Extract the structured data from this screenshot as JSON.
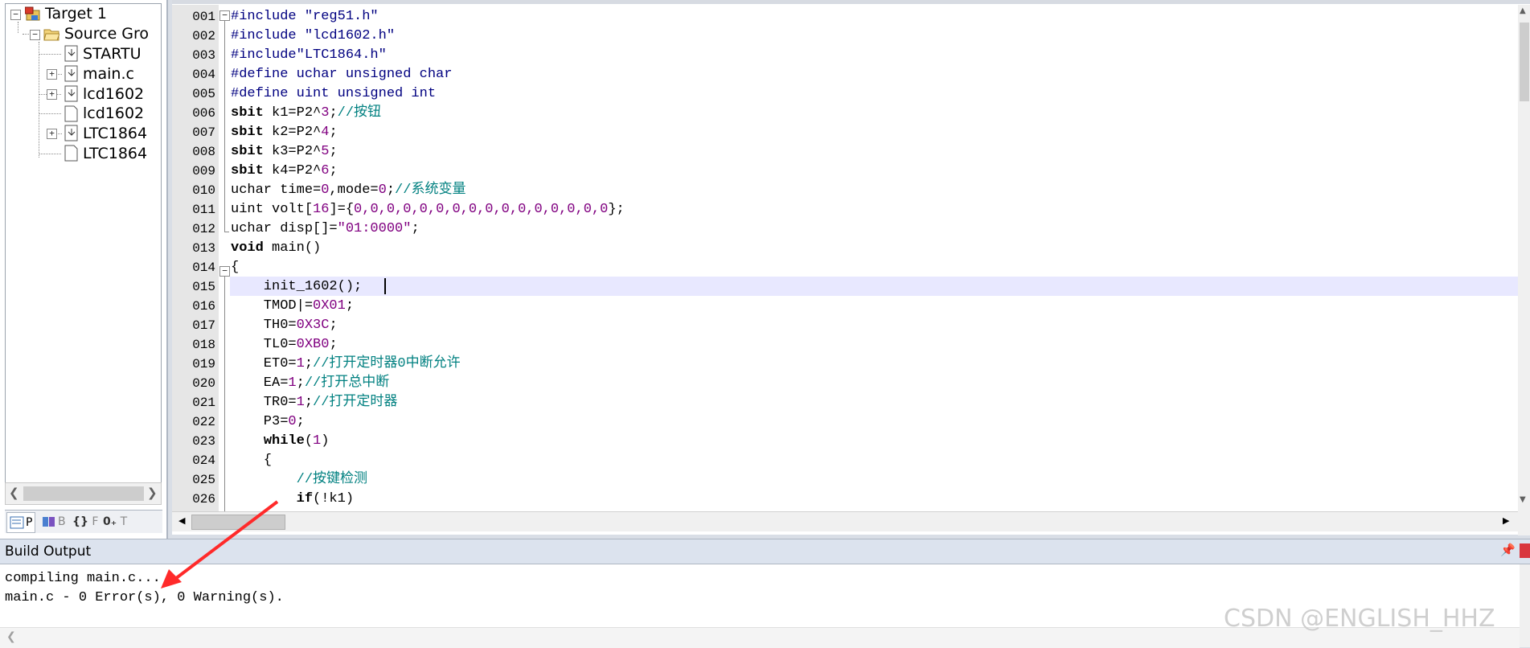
{
  "project_tree": {
    "target": "Target 1",
    "group": "Source Gro",
    "files": [
      "STARTU",
      "main.c",
      "lcd1602",
      "lcd1602",
      "LTC1864",
      "LTC1864"
    ]
  },
  "panel_tabs": [
    "P",
    "B",
    "F",
    "T"
  ],
  "editor": {
    "line_numbers": [
      "001",
      "002",
      "003",
      "004",
      "005",
      "006",
      "007",
      "008",
      "009",
      "010",
      "011",
      "012",
      "013",
      "014",
      "015",
      "016",
      "017",
      "018",
      "019",
      "020",
      "021",
      "022",
      "023",
      "024",
      "025",
      "026"
    ],
    "lines": [
      [
        {
          "t": "#include \"reg51.h\"",
          "c": "pp"
        }
      ],
      [
        {
          "t": "#include \"lcd1602.h\"",
          "c": "pp"
        }
      ],
      [
        {
          "t": "#include\"LTC1864.h\"",
          "c": "pp"
        }
      ],
      [
        {
          "t": "#define uchar unsigned char",
          "c": "pp"
        }
      ],
      [
        {
          "t": "#define uint unsigned int",
          "c": "pp"
        }
      ],
      [
        {
          "t": "sbit",
          "c": "kw"
        },
        {
          "t": " k1=P2^",
          "c": ""
        },
        {
          "t": "3",
          "c": "num"
        },
        {
          "t": ";",
          "c": ""
        },
        {
          "t": "//按钮",
          "c": "cm"
        }
      ],
      [
        {
          "t": "sbit",
          "c": "kw"
        },
        {
          "t": " k2=P2^",
          "c": ""
        },
        {
          "t": "4",
          "c": "num"
        },
        {
          "t": ";",
          "c": ""
        }
      ],
      [
        {
          "t": "sbit",
          "c": "kw"
        },
        {
          "t": " k3=P2^",
          "c": ""
        },
        {
          "t": "5",
          "c": "num"
        },
        {
          "t": ";",
          "c": ""
        }
      ],
      [
        {
          "t": "sbit",
          "c": "kw"
        },
        {
          "t": " k4=P2^",
          "c": ""
        },
        {
          "t": "6",
          "c": "num"
        },
        {
          "t": ";",
          "c": ""
        }
      ],
      [
        {
          "t": "uchar time=",
          "c": ""
        },
        {
          "t": "0",
          "c": "num"
        },
        {
          "t": ",mode=",
          "c": ""
        },
        {
          "t": "0",
          "c": "num"
        },
        {
          "t": ";",
          "c": ""
        },
        {
          "t": "//系统变量",
          "c": "cm"
        }
      ],
      [
        {
          "t": "uint volt[",
          "c": ""
        },
        {
          "t": "16",
          "c": "num"
        },
        {
          "t": "]={",
          "c": ""
        },
        {
          "t": "0,0,0,0,0,0,0,0,0,0,0,0,0,0,0,0",
          "c": "num"
        },
        {
          "t": "};",
          "c": ""
        }
      ],
      [
        {
          "t": "uchar disp[]=",
          "c": ""
        },
        {
          "t": "\"01:0000\"",
          "c": "str"
        },
        {
          "t": ";",
          "c": ""
        }
      ],
      [
        {
          "t": "void",
          "c": "kw"
        },
        {
          "t": " main()",
          "c": ""
        }
      ],
      [
        {
          "t": "{",
          "c": ""
        }
      ],
      [
        {
          "t": "    init_1602();",
          "c": ""
        }
      ],
      [
        {
          "t": "    TMOD|=",
          "c": ""
        },
        {
          "t": "0X01",
          "c": "num"
        },
        {
          "t": ";",
          "c": ""
        }
      ],
      [
        {
          "t": "    TH0=",
          "c": ""
        },
        {
          "t": "0X3C",
          "c": "num"
        },
        {
          "t": ";",
          "c": ""
        }
      ],
      [
        {
          "t": "    TL0=",
          "c": ""
        },
        {
          "t": "0XB0",
          "c": "num"
        },
        {
          "t": ";",
          "c": ""
        }
      ],
      [
        {
          "t": "    ET0=",
          "c": ""
        },
        {
          "t": "1",
          "c": "num"
        },
        {
          "t": ";",
          "c": ""
        },
        {
          "t": "//打开定时器0中断允许",
          "c": "cm"
        }
      ],
      [
        {
          "t": "    EA=",
          "c": ""
        },
        {
          "t": "1",
          "c": "num"
        },
        {
          "t": ";",
          "c": ""
        },
        {
          "t": "//打开总中断",
          "c": "cm"
        }
      ],
      [
        {
          "t": "    TR0=",
          "c": ""
        },
        {
          "t": "1",
          "c": "num"
        },
        {
          "t": ";",
          "c": ""
        },
        {
          "t": "//打开定时器",
          "c": "cm"
        }
      ],
      [
        {
          "t": "    P3=",
          "c": ""
        },
        {
          "t": "0",
          "c": "num"
        },
        {
          "t": ";",
          "c": ""
        }
      ],
      [
        {
          "t": "    ",
          "c": ""
        },
        {
          "t": "while",
          "c": "kw"
        },
        {
          "t": "(",
          "c": ""
        },
        {
          "t": "1",
          "c": "num"
        },
        {
          "t": ")",
          "c": ""
        }
      ],
      [
        {
          "t": "    {",
          "c": ""
        }
      ],
      [
        {
          "t": "        ",
          "c": ""
        },
        {
          "t": "//按键检测",
          "c": "cm"
        }
      ],
      [
        {
          "t": "        ",
          "c": ""
        },
        {
          "t": "if",
          "c": "kw"
        },
        {
          "t": "(!k1)",
          "c": ""
        }
      ]
    ]
  },
  "build_output": {
    "title": "Build Output",
    "lines": [
      "compiling main.c...",
      "main.c - 0 Error(s), 0 Warning(s)."
    ]
  },
  "watermark": "CSDN @ENGLISH_HHZ",
  "colors": {
    "comment": "#008080",
    "number": "#800080",
    "current_line": "#e8e8ff",
    "annotation_arrow": "#ff2a2a"
  }
}
